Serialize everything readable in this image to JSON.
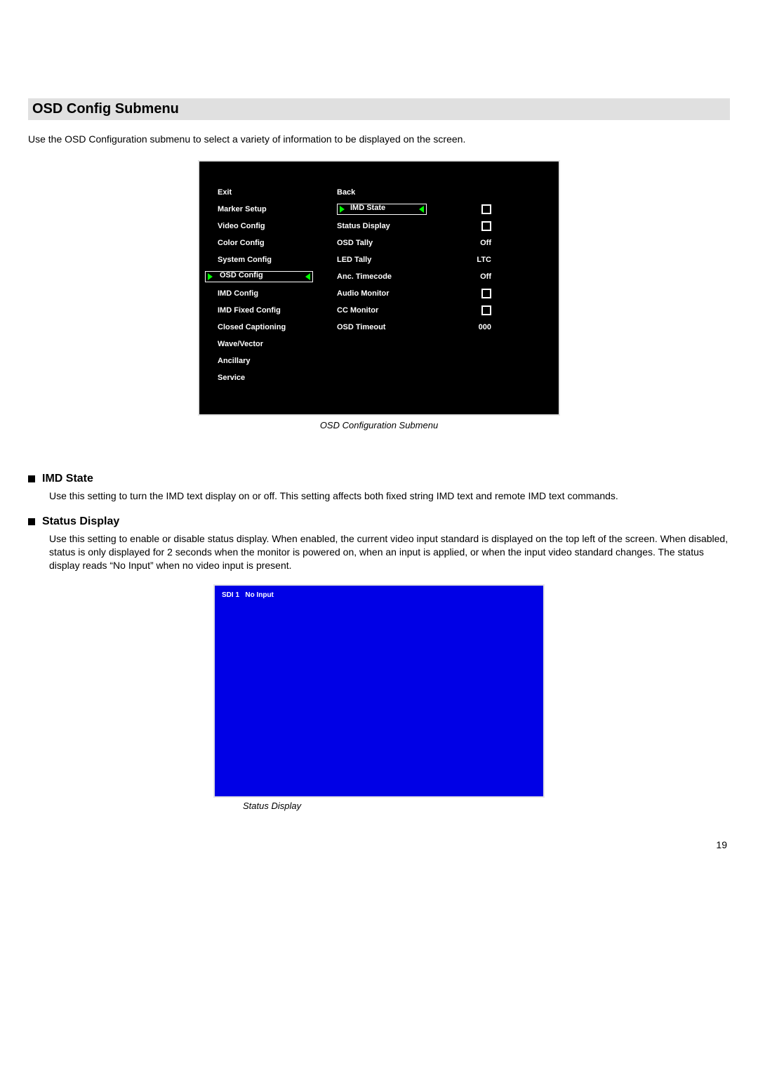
{
  "title": "OSD Config Submenu",
  "intro": "Use the OSD Configuration submenu to select a variety of information to be displayed on the screen.",
  "menu_left": [
    "Exit",
    "Marker Setup",
    "Video Config",
    "Color Config",
    "System Config",
    "OSD Config",
    "IMD Config",
    "IMD Fixed Config",
    "Closed Captioning",
    "Wave/Vector",
    "Ancillary",
    "Service"
  ],
  "menu_right": [
    {
      "label": "Back",
      "value": ""
    },
    {
      "label": "IMD State",
      "value": "checkbox"
    },
    {
      "label": "Status Display",
      "value": "checkbox"
    },
    {
      "label": "OSD Tally",
      "value": "Off"
    },
    {
      "label": "LED Tally",
      "value": "LTC"
    },
    {
      "label": "Anc. Timecode",
      "value": "Off"
    },
    {
      "label": "Audio Monitor",
      "value": "checkbox"
    },
    {
      "label": "CC Monitor",
      "value": "checkbox"
    },
    {
      "label": "OSD Timeout",
      "value": "000"
    }
  ],
  "caption1": "OSD Configuration Submenu",
  "sections": [
    {
      "heading": "IMD State",
      "body": "Use this setting to turn the IMD text display on or off. This setting affects both fixed string IMD text and remote IMD text commands."
    },
    {
      "heading": "Status Display",
      "body": "Use this setting to enable or disable status display. When enabled, the current video input standard is displayed on the top left of the screen. When disabled, status is only displayed for 2 seconds when the monitor is powered on, when an input is applied, or when the input video standard changes. The status display reads “No Input” when no video input is present."
    }
  ],
  "blue_status": "SDI 1   No Input",
  "caption2": "Status Display",
  "page_number": "19"
}
